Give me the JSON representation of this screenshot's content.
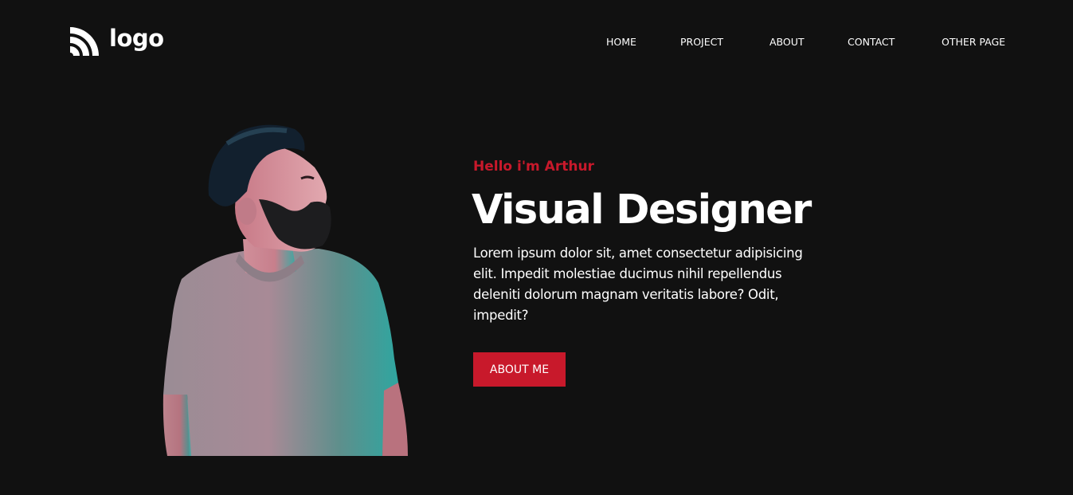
{
  "header": {
    "logo_text": "logo",
    "logo_icon": "wifi-arcs-icon",
    "nav": [
      {
        "label": "HOME"
      },
      {
        "label": "PROJECT"
      },
      {
        "label": "ABOUT"
      },
      {
        "label": "CONTACT"
      },
      {
        "label": "OTHER PAGE"
      }
    ]
  },
  "hero": {
    "greeting": "Hello i'm Arthur",
    "headline": "Visual Designer",
    "intro": "Lorem ipsum dolor sit, amet consectetur adipisicing elit. Impedit molestiae ducimus nihil repellendus deleniti dolorum magnam veritatis labore? Odit, impedit?",
    "button_label": "ABOUT ME"
  },
  "colors": {
    "background": "#111111",
    "accent": "#c8192b",
    "text": "#ffffff"
  }
}
